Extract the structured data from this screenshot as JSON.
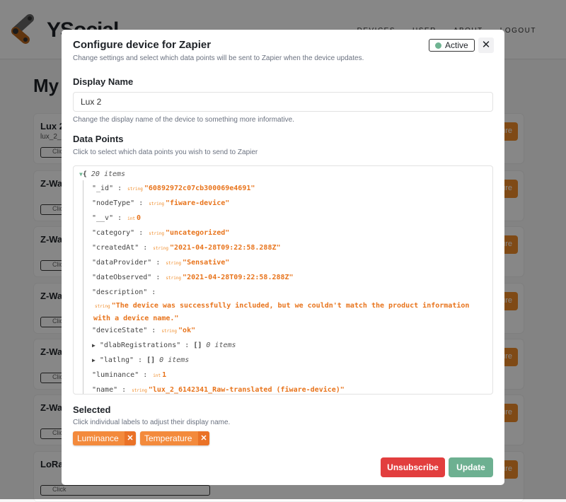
{
  "header": {
    "brand": "YSocial",
    "nav": [
      "DEVICES",
      "USER",
      "ABOUT",
      "LOGOUT"
    ]
  },
  "page": {
    "title": "My Devices",
    "cards": [
      {
        "title": "Lux 2",
        "subtitle": "lux_2_6142341",
        "copy": "Click"
      },
      {
        "title": "Z-Wave",
        "subtitle": "",
        "copy": "Click"
      },
      {
        "title": "Z-Wave",
        "subtitle": "",
        "copy": "Click"
      },
      {
        "title": "Z-Wave",
        "subtitle": "",
        "copy": "Click"
      },
      {
        "title": "Z-Wave",
        "subtitle": "",
        "copy": "Click"
      },
      {
        "title": "Z-Wave",
        "subtitle": "",
        "copy": "Click"
      },
      {
        "title": "LoRa",
        "subtitle": "",
        "copy": "Click"
      }
    ],
    "card_button": "Configure"
  },
  "modal": {
    "title": "Configure device for Zapier",
    "subtitle": "Change settings and select which data points will be sent to Zapier when the device updates.",
    "status": "Active",
    "status_color": "#6fb492",
    "close": "✕",
    "display_name": {
      "label": "Display Name",
      "value": "Lux 2",
      "hint": "Change the display name of the device to something more informative."
    },
    "data_points": {
      "label": "Data Points",
      "hint": "Click to select which data points you wish to send to Zapier",
      "root_count": "20 items",
      "rows": [
        {
          "key": "\"_id\"",
          "type": "string",
          "value": "\"60892972c07cb300069e4691\""
        },
        {
          "key": "\"nodeType\"",
          "type": "string",
          "value": "\"fiware-device\""
        },
        {
          "key": "\"__v\"",
          "type": "int",
          "value": "0"
        },
        {
          "key": "\"category\"",
          "type": "string",
          "value": "\"uncategorized\""
        },
        {
          "key": "\"createdAt\"",
          "type": "string",
          "value": "\"2021-04-28T09:22:58.288Z\""
        },
        {
          "key": "\"dataProvider\"",
          "type": "string",
          "value": "\"Sensative\""
        },
        {
          "key": "\"dateObserved\"",
          "type": "string",
          "value": "\"2021-04-28T09:22:58.288Z\""
        },
        {
          "key": "\"description\"",
          "type": "string",
          "value": "\"The device was successfully included, but we couldn't match the product information with a device name.\""
        },
        {
          "key": "\"deviceState\"",
          "type": "string",
          "value": "\"ok\""
        },
        {
          "key": "\"dlabRegistrations\"",
          "type": "[]",
          "value": "0 items"
        },
        {
          "key": "\"latlng\"",
          "type": "[]",
          "value": "0 items"
        },
        {
          "key": "\"luminance\"",
          "type": "int",
          "value": "1"
        },
        {
          "key": "\"name\"",
          "type": "string",
          "value": "\"lux_2_6142341_Raw-translated (fiware-device)\""
        }
      ]
    },
    "selected": {
      "label": "Selected",
      "hint": "Click individual labels to adjust their display name.",
      "chips": [
        "Luminance",
        "Temperature"
      ]
    },
    "unsubscribe": "Unsubscribe",
    "update": "Update"
  }
}
